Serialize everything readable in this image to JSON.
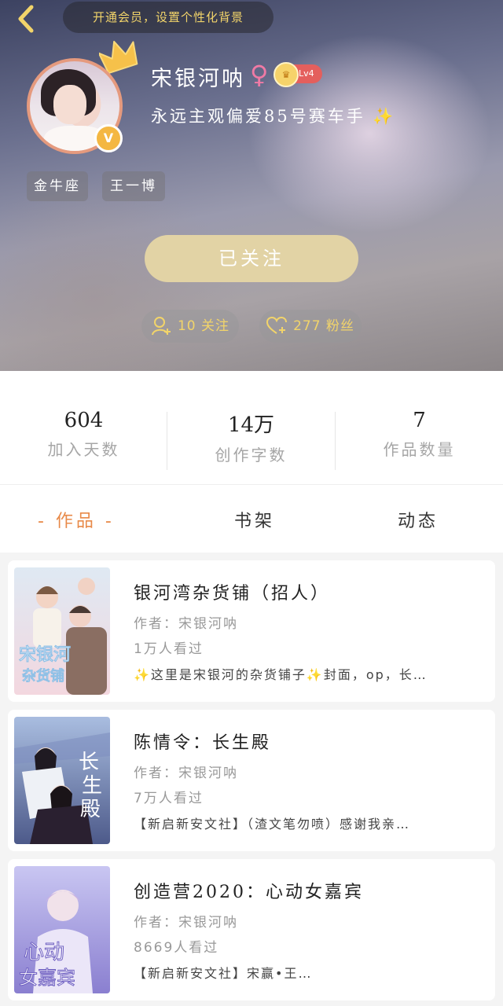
{
  "header": {
    "vip_banner": "开通会员，设置个性化背景"
  },
  "profile": {
    "username": "宋银河呐",
    "gender_symbol": "♀",
    "level": "Lv4",
    "signature": "永远主观偏爱85号赛车手",
    "tags": [
      "金牛座",
      "王一博"
    ],
    "follow_button": "已关注",
    "following": "10 关注",
    "fans": "277 粉丝"
  },
  "stats": [
    {
      "value": "604",
      "label": "加入天数"
    },
    {
      "value": "14万",
      "label": "创作字数"
    },
    {
      "value": "7",
      "label": "作品数量"
    }
  ],
  "tabs": [
    {
      "label": "- 作品 -",
      "active": true
    },
    {
      "label": "书架",
      "active": false
    },
    {
      "label": "动态",
      "active": false
    }
  ],
  "works": [
    {
      "title": "银河湾杂货铺（招人）",
      "author": "作者：宋银河呐",
      "views": "1万人看过",
      "desc_prefix": "✨",
      "description": "这里是宋银河的杂货铺子✨封面，op，长…"
    },
    {
      "title": "陈情令：长生殿",
      "author": "作者：宋银河呐",
      "views": "7万人看过",
      "desc_prefix": "",
      "description": "【新启新安文社】（渣文笔勿喷）感谢我亲…"
    },
    {
      "title": "创造营2020：心动女嘉宾",
      "author": "作者：宋银河呐",
      "views": "8669人看过",
      "desc_prefix": "",
      "description": "【新启新安文社】宋赢•王…"
    }
  ],
  "colors": {
    "accent": "#e88a49",
    "gold": "#f2d46a",
    "follow_button": "#e2d3a5"
  }
}
